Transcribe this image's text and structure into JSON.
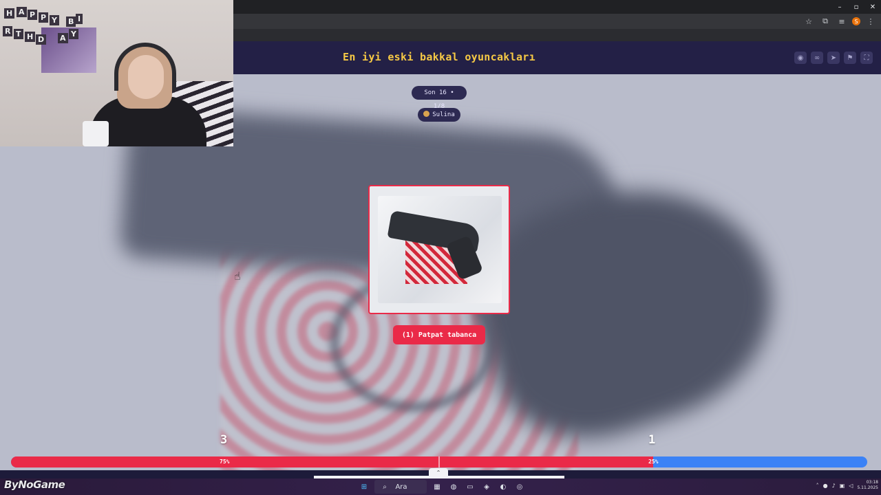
{
  "window_controls": {
    "minimize": "–",
    "restore": "▫",
    "close": "✕"
  },
  "browser_icons": [
    "star-icon",
    "extensions-icon",
    "cast-icon",
    "profile-icon",
    "menu-icon"
  ],
  "browser_profile_initial": "S",
  "app": {
    "title": "En iyi eski bakkal oyuncakları",
    "round_label": "Son 16 • 1/8",
    "user_label": "Sulina",
    "header_icons": [
      "eye-icon",
      "link-icon",
      "send-icon",
      "flag-icon",
      "fullscreen-icon"
    ]
  },
  "choice": {
    "label": "(1) Patpat tabanca",
    "border_color": "#ea2a48"
  },
  "votes": {
    "left_count": "3",
    "right_count": "1",
    "left_percent_label": "75%",
    "right_percent_label": "25%",
    "left_fraction": 0.75,
    "left_color": "#ea2a48",
    "right_color": "#3b82f6"
  },
  "taskbar": {
    "search_placeholder": "Ara",
    "time": "03:18",
    "date": "5.11.2025"
  },
  "webcam_banner": [
    "H",
    "A",
    "P",
    "P",
    "Y",
    "B",
    "I",
    "R",
    "T",
    "H",
    "D",
    "A",
    "Y"
  ],
  "watermark": "ByNoGame",
  "colors": {
    "title_yellow": "#f6c945",
    "header_bg": "#232046"
  }
}
